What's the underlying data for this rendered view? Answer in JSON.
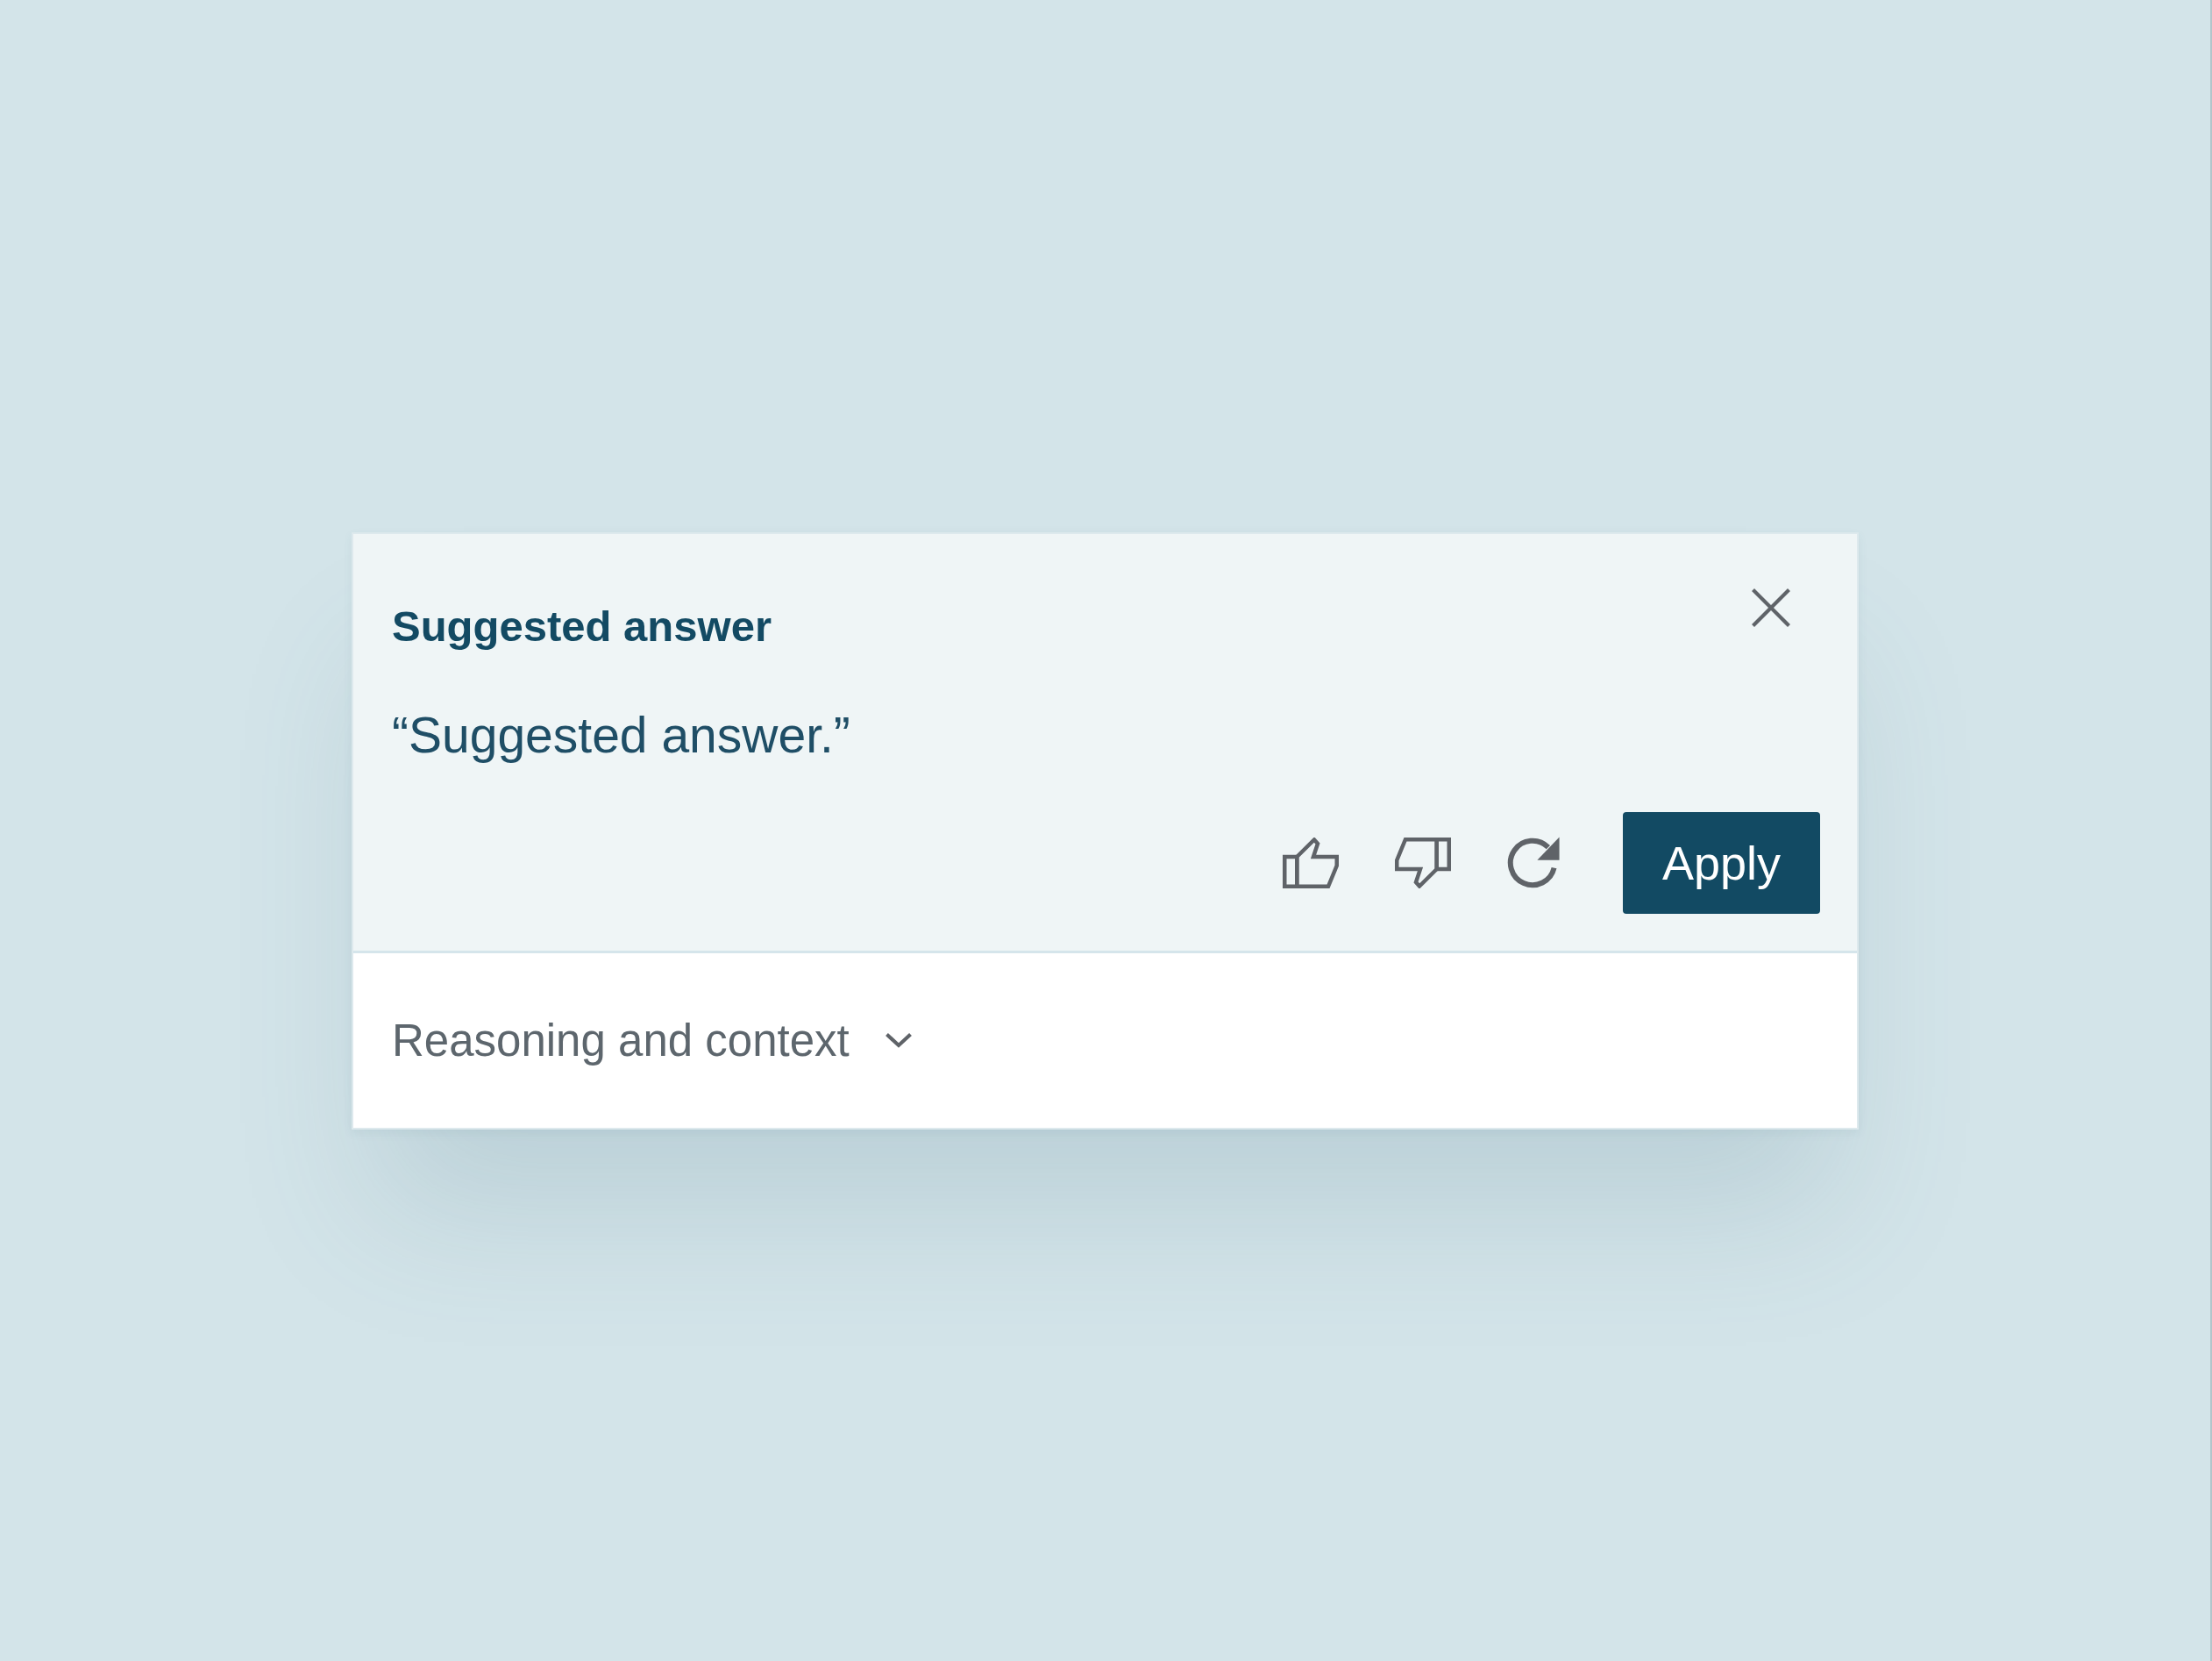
{
  "card": {
    "title": "Suggested answer",
    "answer": "“Suggested answer.”",
    "apply_button": "Apply"
  },
  "details": {
    "label": "Reasoning and context",
    "expanded": false
  }
}
